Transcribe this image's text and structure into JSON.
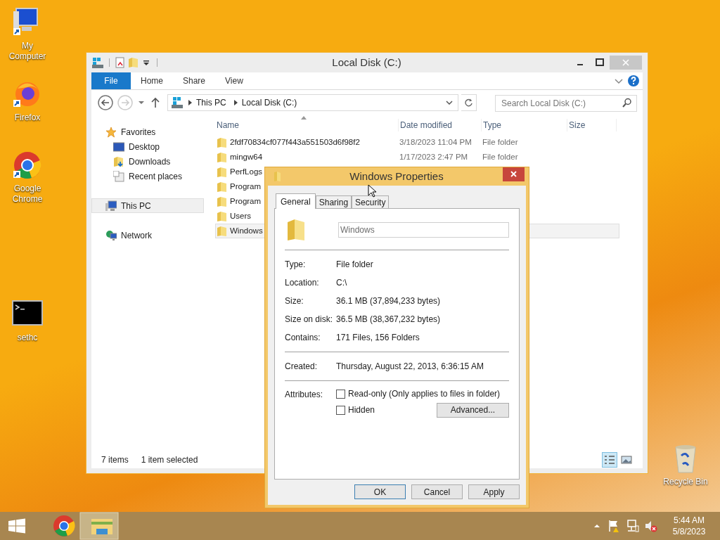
{
  "desktop_icons": [
    {
      "label": "My Computer",
      "kind": "computer"
    },
    {
      "label": "Firefox",
      "kind": "firefox"
    },
    {
      "label": "Google Chrome",
      "kind": "chrome"
    },
    {
      "label": "sethc",
      "kind": "console"
    },
    {
      "label": "Recycle Bin",
      "kind": "bin"
    }
  ],
  "explorer": {
    "title": "Local Disk (C:)",
    "ribbon_tabs": [
      {
        "label": "File",
        "selected": true
      },
      {
        "label": "Home",
        "selected": false
      },
      {
        "label": "Share",
        "selected": false
      },
      {
        "label": "View",
        "selected": false
      }
    ],
    "breadcrumb": [
      "This PC",
      "Local Disk (C:)"
    ],
    "search": {
      "placeholder": "Search Local Disk (C:)"
    },
    "nav": [
      {
        "label": "Favorites",
        "kind": "star",
        "selected": false,
        "children": [
          {
            "label": "Desktop",
            "kind": "desktop",
            "selected": false
          },
          {
            "label": "Downloads",
            "kind": "downloads",
            "selected": false
          },
          {
            "label": "Recent places",
            "kind": "recent",
            "selected": false
          }
        ]
      },
      {
        "label": "This PC",
        "kind": "pc",
        "selected": true
      },
      {
        "label": "Network",
        "kind": "network",
        "selected": false
      }
    ],
    "columns": [
      "Name",
      "Date modified",
      "Type",
      "Size"
    ],
    "rows": [
      {
        "name": "2fdf70834cf077f443a551503d6f98f2",
        "date": "3/18/2023 11:04 PM",
        "type": "File folder",
        "selected": false
      },
      {
        "name": "mingw64",
        "date": "1/17/2023 2:47 PM",
        "type": "File folder",
        "selected": false
      },
      {
        "name": "PerfLogs",
        "selected": false
      },
      {
        "name": "Program",
        "selected": false
      },
      {
        "name": "Program",
        "selected": false
      },
      {
        "name": "Users",
        "selected": false
      },
      {
        "name": "Windows",
        "selected": true
      }
    ],
    "status": [
      "7 items",
      "1 item selected"
    ]
  },
  "dialog": {
    "title": "Windows Properties",
    "tabs": [
      {
        "label": "General",
        "selected": true
      },
      {
        "label": "Sharing",
        "selected": false
      },
      {
        "label": "Security",
        "selected": false
      }
    ],
    "name_field": {
      "value": "Windows"
    },
    "groups": [
      [
        {
          "label": "Type:",
          "value": "File folder"
        },
        {
          "label": "Location:",
          "value": "C:\\"
        },
        {
          "label": "Size:",
          "value": "36.1 MB (37,894,233 bytes)"
        },
        {
          "label": "Size on disk:",
          "value": "36.5 MB (38,367,232 bytes)"
        },
        {
          "label": "Contains:",
          "value": "171 Files, 156 Folders"
        }
      ],
      [
        {
          "label": "Created:",
          "value": "Thursday, August 22, 2013, 6:36:15 AM"
        }
      ]
    ],
    "attributes_label": "Attributes:",
    "attributes": [
      {
        "label": "Read-only (Only applies to files in folder)",
        "checked": false
      },
      {
        "label": "Hidden",
        "checked": false
      }
    ],
    "advanced_button": "Advanced...",
    "buttons": [
      "OK",
      "Cancel",
      "Apply"
    ]
  },
  "taskbar": {
    "apps": [
      {
        "kind": "chrome",
        "selected": false
      },
      {
        "kind": "explorer",
        "selected": true
      }
    ],
    "time": "5:44 AM",
    "date": "5/8/2023"
  }
}
